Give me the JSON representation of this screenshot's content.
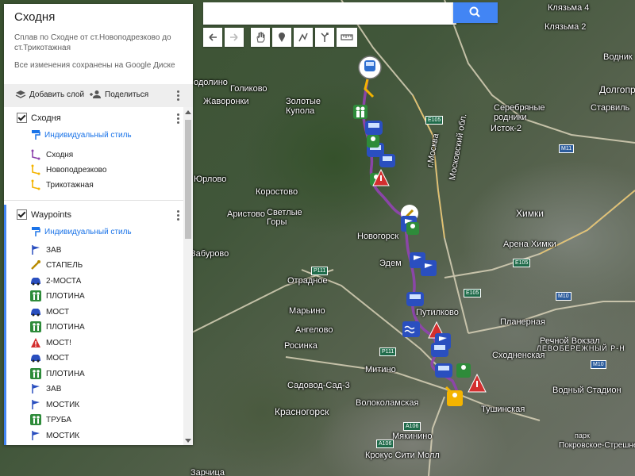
{
  "search": {
    "placeholder": ""
  },
  "toolbar": {
    "tools": [
      {
        "name": "undo-icon"
      },
      {
        "name": "redo-icon"
      },
      {
        "name": "hand-icon"
      },
      {
        "name": "marker-icon"
      },
      {
        "name": "draw-line-icon"
      },
      {
        "name": "directions-icon"
      },
      {
        "name": "ruler-icon"
      }
    ]
  },
  "panel": {
    "title": "Сходня",
    "description": "Сплав по Сходне от ст.Новоподрезково до ст.Трикотажная",
    "saved": "Все изменения сохранены на Google Диске",
    "add_layer": "Добавить слой",
    "share": "Поделиться"
  },
  "layers": [
    {
      "title": "Сходня",
      "style": "Индивидуальный стиль",
      "items": [
        {
          "label": "Сходня",
          "icon": "route-icon",
          "color": "#8e44ad"
        },
        {
          "label": "Новоподрезково",
          "icon": "route-icon",
          "color": "#f4b400"
        },
        {
          "label": "Трикотажная",
          "icon": "route-icon",
          "color": "#f4b400"
        }
      ]
    },
    {
      "title": "Waypoints",
      "style": "Индивидуальный стиль",
      "items": [
        {
          "label": "ЗАВ",
          "icon": "flag-icon"
        },
        {
          "label": "СТАПЕЛЬ",
          "icon": "key-icon"
        },
        {
          "label": "2-МОСТА",
          "icon": "car-icon"
        },
        {
          "label": "ПЛОТИНА",
          "icon": "hikers-icon"
        },
        {
          "label": "МОСТ",
          "icon": "car-icon"
        },
        {
          "label": "ПЛОТИНА",
          "icon": "hikers-icon"
        },
        {
          "label": "МОСТ!",
          "icon": "warning-icon"
        },
        {
          "label": "МОСТ",
          "icon": "car-icon"
        },
        {
          "label": "ПЛОТИНА",
          "icon": "hikers-icon"
        },
        {
          "label": "ЗАВ",
          "icon": "flag-icon"
        },
        {
          "label": "МОСТИК",
          "icon": "flag-icon"
        },
        {
          "label": "ТРУБА",
          "icon": "hikers-icon"
        },
        {
          "label": "МОСТИК",
          "icon": "flag-icon"
        }
      ]
    }
  ],
  "map_labels": [
    {
      "text": "Клязьма 4",
      "kind": "normal"
    },
    {
      "text": "Клязьма 2",
      "kind": "normal"
    },
    {
      "text": "Водник",
      "kind": "normal"
    },
    {
      "text": "Долгопр",
      "kind": "big"
    },
    {
      "text": "Серебряные родники",
      "kind": "normal"
    },
    {
      "text": "Исток-2",
      "kind": "normal"
    },
    {
      "text": "Старвиль",
      "kind": "normal"
    },
    {
      "text": "Голиково",
      "kind": "normal"
    },
    {
      "text": "Жаворонки",
      "kind": "normal"
    },
    {
      "text": "Золотые Купола",
      "kind": "normal"
    },
    {
      "text": "Юрлово",
      "kind": "normal"
    },
    {
      "text": "Коростово",
      "kind": "normal"
    },
    {
      "text": "Аристово",
      "kind": "normal"
    },
    {
      "text": "Светлые Горы",
      "kind": "normal"
    },
    {
      "text": "Химки",
      "kind": "big"
    },
    {
      "text": "Арена Химки",
      "kind": "normal"
    },
    {
      "text": "Новогорск",
      "kind": "normal"
    },
    {
      "text": "Эдем",
      "kind": "normal"
    },
    {
      "text": "Отрадное",
      "kind": "normal"
    },
    {
      "text": "Марьино",
      "kind": "normal"
    },
    {
      "text": "Путилково",
      "kind": "normal"
    },
    {
      "text": "Планерная",
      "kind": "normal"
    },
    {
      "text": "Ангелово",
      "kind": "normal"
    },
    {
      "text": "Речной Вокзал",
      "kind": "normal"
    },
    {
      "text": "Сходненская",
      "kind": "normal"
    },
    {
      "text": "ЛЕВОБЕРЕЖНЫЙ Р-Н",
      "kind": "cap"
    },
    {
      "text": "Росинка",
      "kind": "normal"
    },
    {
      "text": "Митино",
      "kind": "normal"
    },
    {
      "text": "Водный Стадион",
      "kind": "normal"
    },
    {
      "text": "Садовод-Сад-3",
      "kind": "normal"
    },
    {
      "text": "Волоколамская",
      "kind": "normal"
    },
    {
      "text": "Красногорск",
      "kind": "big"
    },
    {
      "text": "Тушинская",
      "kind": "normal"
    },
    {
      "text": "Мякинино",
      "kind": "normal"
    },
    {
      "text": "Покровское-Стрешнево",
      "kind": "normal"
    },
    {
      "text": "Крокус Сити Молл",
      "kind": "normal"
    },
    {
      "text": "Забурово",
      "kind": "normal"
    },
    {
      "text": "Московский обл.",
      "kind": "normal"
    },
    {
      "text": "г.Москва",
      "kind": "normal"
    },
    {
      "text": "одолино",
      "kind": "normal"
    },
    {
      "text": "парк",
      "kind": "normal"
    },
    {
      "text": "Зарчица",
      "kind": "normal"
    }
  ],
  "road_shields": [
    "E105",
    "M11",
    "E105",
    "M10",
    "P111",
    "P111",
    "E105",
    "A106",
    "A106",
    "M10"
  ]
}
